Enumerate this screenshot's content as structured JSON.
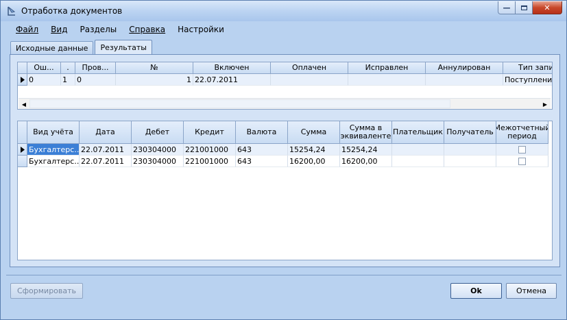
{
  "window": {
    "title": "Отработка документов"
  },
  "menu": [
    {
      "label": "Файл"
    },
    {
      "label": "Вид"
    },
    {
      "label": "Разделы"
    },
    {
      "label": "Справка"
    },
    {
      "label": "Настройки"
    }
  ],
  "tabs": [
    {
      "label": "Исходные данные"
    },
    {
      "label": "Результаты"
    }
  ],
  "grid1": {
    "columns": [
      "Ош...",
      ".",
      "Пров...",
      "№",
      "Включен",
      "Оплачен",
      "Исправлен",
      "Аннулирован",
      "Тип запи"
    ],
    "rows": [
      [
        "0",
        "1",
        "0",
        "1",
        "22.07.2011",
        "",
        "",
        "",
        "Поступление"
      ]
    ]
  },
  "grid2": {
    "columns": [
      "Вид учёта",
      "Дата",
      "Дебет",
      "Кредит",
      "Валюта",
      "Сумма",
      "Сумма в эквиваленте",
      "Плательщик",
      "Получатель",
      "Межотчетный период"
    ],
    "rows": [
      [
        "Бухгалтерс...",
        "22.07.2011",
        "230304000",
        "221001000",
        "643",
        "15254,24",
        "15254,24",
        "",
        ""
      ],
      [
        "Бухгалтерс...",
        "22.07.2011",
        "230304000",
        "221001000",
        "643",
        "16200,00",
        "16200,00",
        "",
        ""
      ]
    ]
  },
  "buttons": {
    "generate": "Сформировать",
    "ok": "Ok",
    "cancel": "Отмена"
  },
  "colors": {
    "accent": "#3b7fd6",
    "close": "#c8482a"
  }
}
